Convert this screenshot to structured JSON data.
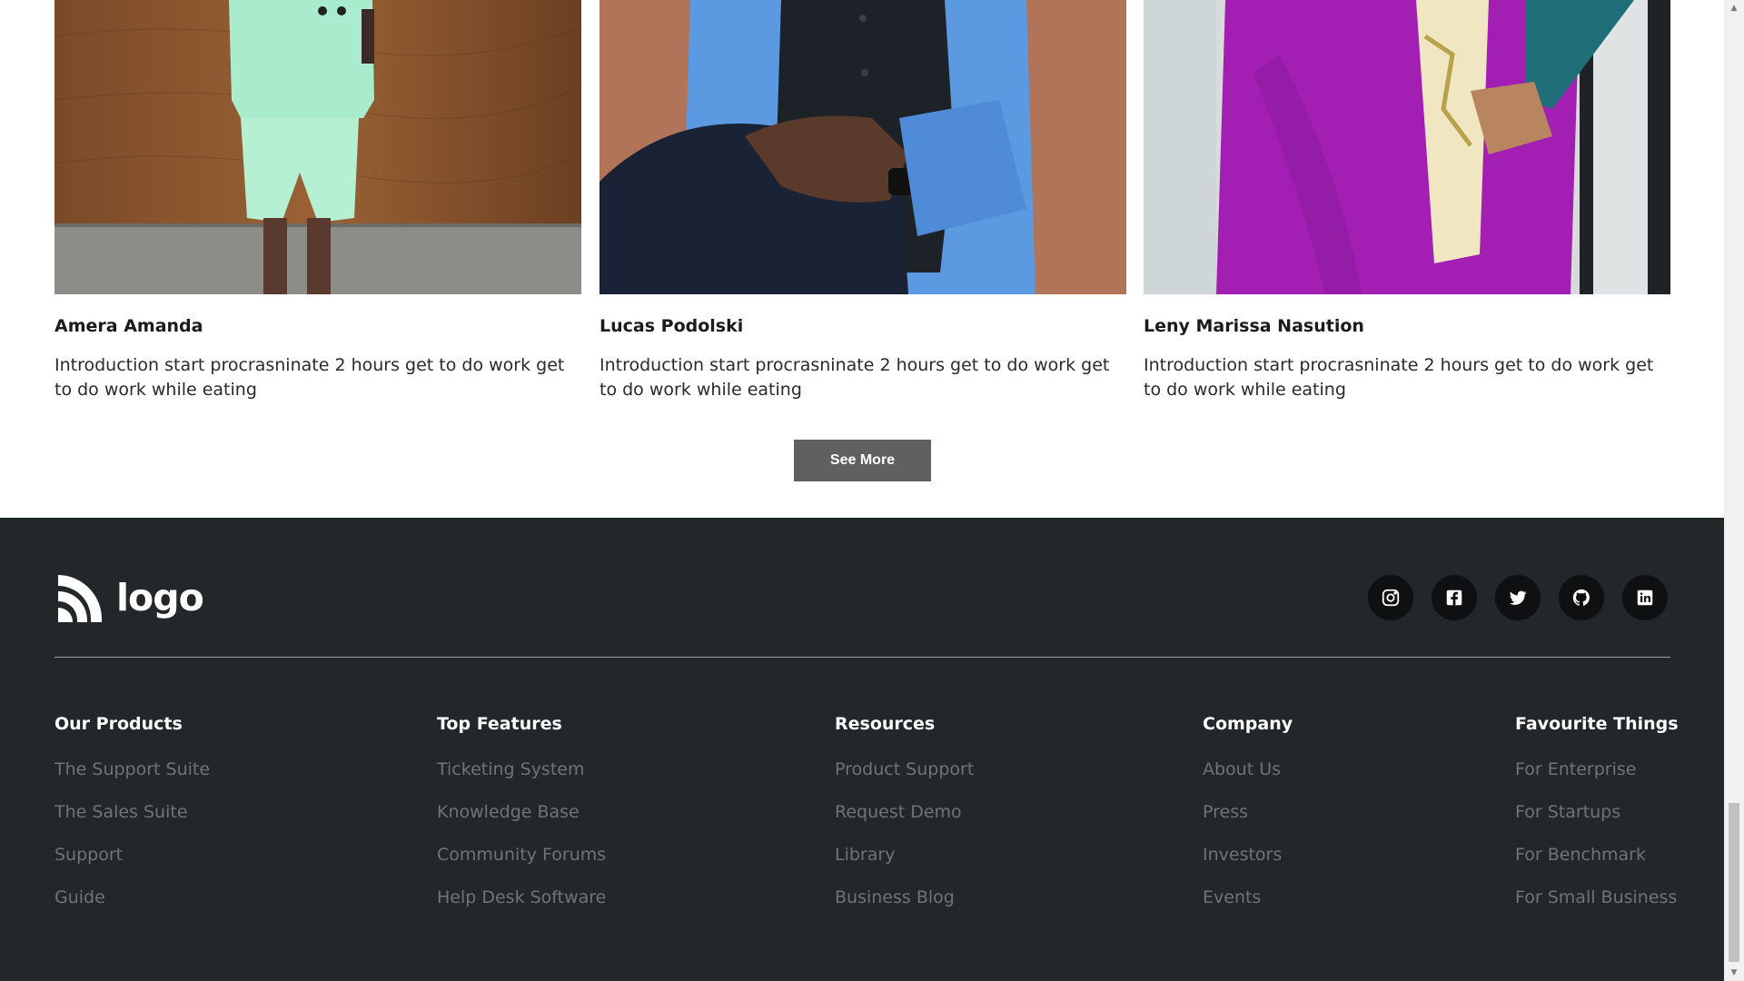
{
  "team": {
    "members": [
      {
        "name": "Amera Amanda",
        "description": "Introduction start procrasninate 2 hours get to do work get to do work while eating"
      },
      {
        "name": "Lucas Podolski",
        "description": "Introduction start procrasninate 2 hours get to do work get to do work while eating"
      },
      {
        "name": "Leny Marissa Nasution",
        "description": "Introduction start procrasninate 2 hours get to do work get to do work while eating"
      }
    ],
    "see_more_label": "See More"
  },
  "footer": {
    "logo_text": "logo",
    "socials": [
      "instagram-icon",
      "facebook-icon",
      "twitter-icon",
      "github-icon",
      "linkedin-icon"
    ],
    "columns": [
      {
        "title": "Our Products",
        "links": [
          "The Support Suite",
          "The Sales Suite",
          "Support",
          "Guide"
        ]
      },
      {
        "title": "Top Features",
        "links": [
          "Ticketing System",
          "Knowledge Base",
          "Community Forums",
          "Help Desk Software"
        ]
      },
      {
        "title": "Resources",
        "links": [
          "Product Support",
          "Request Demo",
          "Library",
          "Business Blog"
        ]
      },
      {
        "title": "Company",
        "links": [
          "About Us",
          "Press",
          "Investors",
          "Events"
        ]
      },
      {
        "title": "Favourite Things",
        "links": [
          "For Enterprise",
          "For Startups",
          "For Benchmark",
          "For Small Business"
        ]
      }
    ]
  },
  "colors": {
    "footer_bg": "#22272a",
    "button_bg": "#606060",
    "link_muted": "#6e7477"
  }
}
